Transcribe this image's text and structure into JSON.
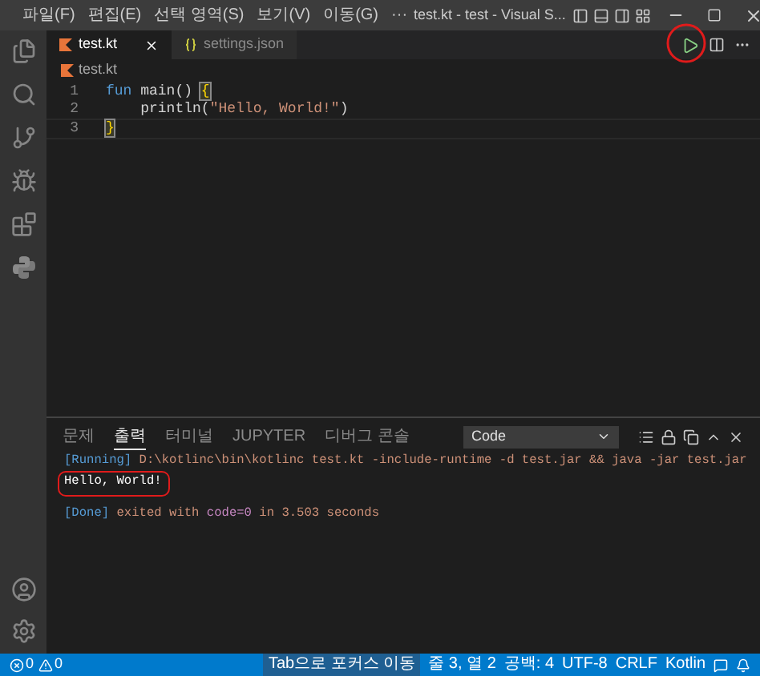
{
  "menu": [
    "파일(F)",
    "편집(E)",
    "선택 영역(S)",
    "보기(V)",
    "이동(G)",
    "···"
  ],
  "window": {
    "title": "test.kt - test - Visual S..."
  },
  "tabs": [
    {
      "label": "test.kt",
      "kind": "kotlin",
      "selected": true
    },
    {
      "label": "settings.json",
      "kind": "json",
      "selected": false
    }
  ],
  "breadcrumb": "test.kt",
  "code": [
    {
      "number": "1",
      "tokens": [
        {
          "text": "fun",
          "kind": "keyword"
        },
        {
          "text": " main() ",
          "kind": "plain"
        },
        {
          "text": "{",
          "kind": "bracket"
        }
      ]
    },
    {
      "number": "2",
      "tokens": [
        {
          "text": "    println(",
          "kind": "plain"
        },
        {
          "text": "\"Hello, World!\"",
          "kind": "string"
        },
        {
          "text": ")",
          "kind": "plain"
        }
      ]
    },
    {
      "number": "3",
      "tokens": [
        {
          "text": "}",
          "kind": "bracket"
        }
      ]
    }
  ],
  "panel": {
    "tabs": [
      {
        "label": "문제",
        "selected": false
      },
      {
        "label": "출력",
        "selected": true
      },
      {
        "label": "터미널",
        "selected": false
      },
      {
        "label": "JUPYTER",
        "selected": false
      },
      {
        "label": "디버그 콘솔",
        "selected": false
      }
    ],
    "channel": {
      "value": "Code"
    },
    "output": [
      [
        {
          "text": "[Running]",
          "kind": "info"
        },
        {
          "text": " D:\\kotlinc\\bin\\kotlinc test.kt -include-runtime -d test.jar && java -jar test.jar",
          "kind": "text"
        }
      ],
      [
        {
          "text": "Hello, World!",
          "kind": "plain"
        }
      ],
      [
        {
          "text": "[Done]",
          "kind": "info"
        },
        {
          "text": " exited with ",
          "kind": "text"
        },
        {
          "text": "code=0",
          "kind": "code"
        },
        {
          "text": " in 3.503 seconds",
          "kind": "text"
        }
      ]
    ]
  },
  "status_bar": {
    "errors": "0",
    "warnings": "0",
    "items": [
      "Tab으로 포커스 이동",
      "줄 3, 열 2",
      "공백: 4",
      "UTF-8",
      "CRLF",
      "Kotlin"
    ]
  }
}
